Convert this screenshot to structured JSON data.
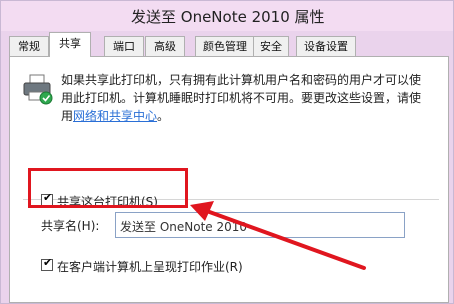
{
  "window": {
    "title": "发送至 OneNote 2010 属性"
  },
  "tabs": [
    {
      "label": "常规",
      "active": false
    },
    {
      "label": "共享",
      "active": true
    },
    {
      "label": "端口",
      "active": false
    },
    {
      "label": "高级",
      "active": false
    },
    {
      "label": "颜色管理",
      "active": false
    },
    {
      "label": "安全",
      "active": false
    },
    {
      "label": "设备设置",
      "active": false
    }
  ],
  "sharing": {
    "description_line1": "如果共享此打印机，只有拥有此计算机用户名和密码的用户才可以使",
    "description_line2": "用此打印机。计算机睡眠时打印机将不可用。要更改这些设置，请使",
    "description_line3_prefix": "用",
    "network_link": "网络和共享中心",
    "description_line3_suffix": "。",
    "share_checkbox_label": "共享这台打印机(S)",
    "share_checked": true,
    "share_name_label": "共享名(H):",
    "share_name_value": "发送至 OneNote 2010",
    "render_jobs_label": "在客户端计算机上呈现打印作业(R)",
    "render_jobs_checked": true
  },
  "annotation": {
    "color": "#e0161f"
  }
}
